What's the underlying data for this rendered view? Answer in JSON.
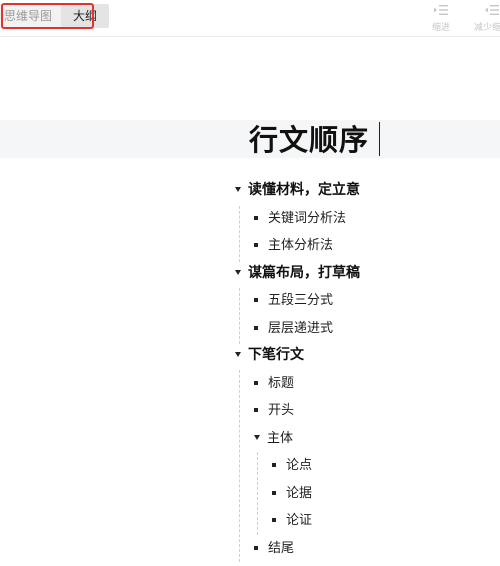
{
  "toolbar": {
    "tabs": [
      {
        "label": "思维导图",
        "active": false
      },
      {
        "label": "大纲",
        "active": true
      }
    ],
    "buttons": [
      {
        "label": "缩进",
        "icon": "indent-icon"
      },
      {
        "label": "减少缩进",
        "icon": "outdent-icon"
      }
    ],
    "highlight_color": "#e23333"
  },
  "document": {
    "title": "行文顺序"
  },
  "outline": [
    {
      "label": "读懂材料，定立意",
      "children": [
        {
          "label": "关键词分析法"
        },
        {
          "label": "主体分析法"
        }
      ]
    },
    {
      "label": "谋篇布局，打草稿",
      "children": [
        {
          "label": "五段三分式"
        },
        {
          "label": "层层递进式"
        }
      ]
    },
    {
      "label": "下笔行文",
      "children": [
        {
          "label": "标题"
        },
        {
          "label": "开头"
        },
        {
          "label": "主体",
          "children": [
            {
              "label": "论点"
            },
            {
              "label": "论据"
            },
            {
              "label": "论证"
            }
          ]
        },
        {
          "label": "结尾"
        }
      ]
    }
  ]
}
